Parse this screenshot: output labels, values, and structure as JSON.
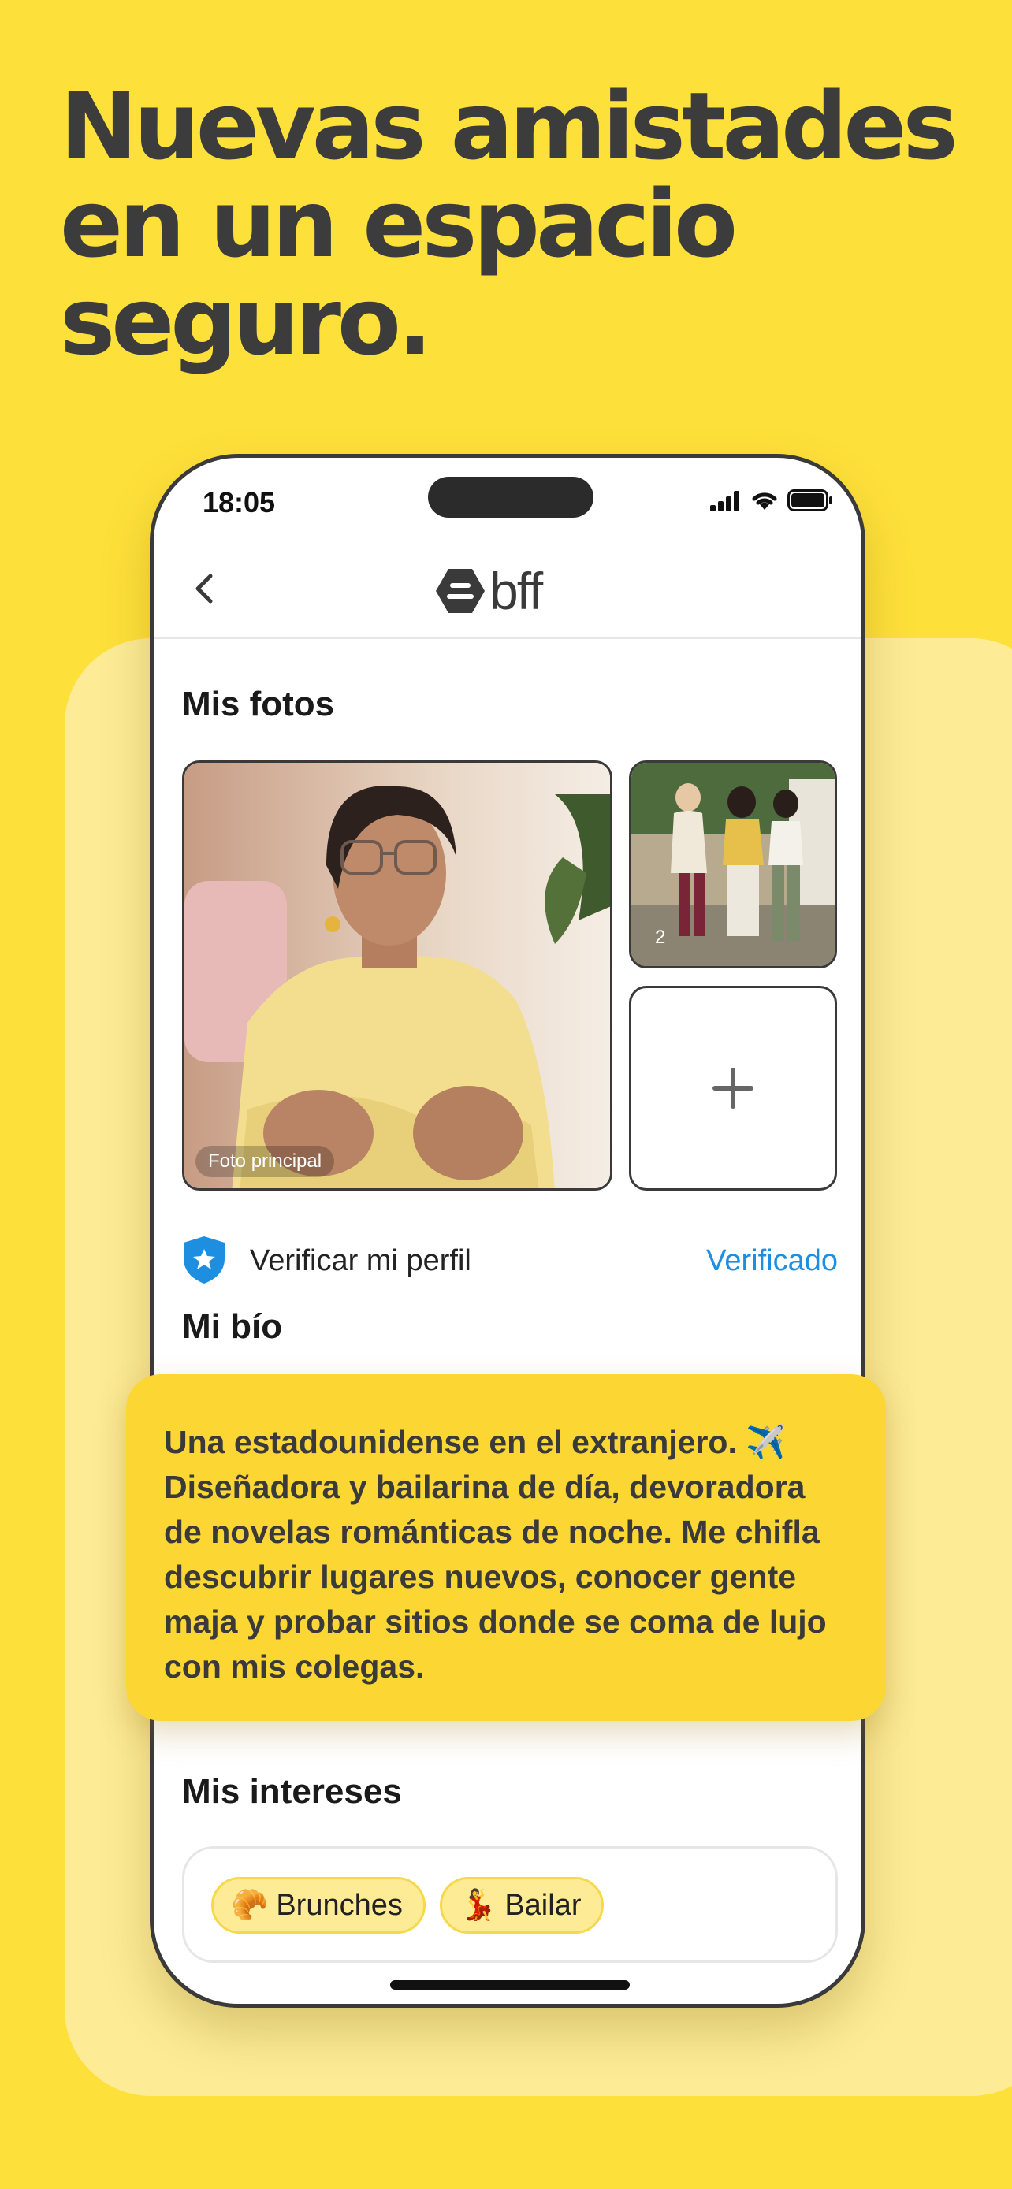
{
  "headline": "Nuevas amistades en un espacio seguro.",
  "status_bar": {
    "time": "18:05"
  },
  "app": {
    "logo_text": "bff"
  },
  "photos": {
    "title": "Mis fotos",
    "main_label": "Foto principal",
    "second_index": "2"
  },
  "verify": {
    "label": "Verificar mi perfil",
    "status": "Verificado"
  },
  "bio": {
    "title": "Mi bío",
    "text": "Una estadounidense en el extranjero. ✈️ Diseñadora y bailarina de día, devoradora de novelas románticas de noche. Me chifla descubrir lugares nuevos, conocer gente maja y probar sitios donde se coma de lujo con mis colegas."
  },
  "interests": {
    "title": "Mis intereses",
    "items": [
      {
        "label": "Brunches",
        "emoji": "🥐"
      },
      {
        "label": "Bailar",
        "emoji": "💃"
      }
    ]
  },
  "colors": {
    "background": "#FEE03A",
    "panel": "#FDEB96",
    "card": "#FCD734",
    "accent_blue": "#1E8FE0"
  }
}
